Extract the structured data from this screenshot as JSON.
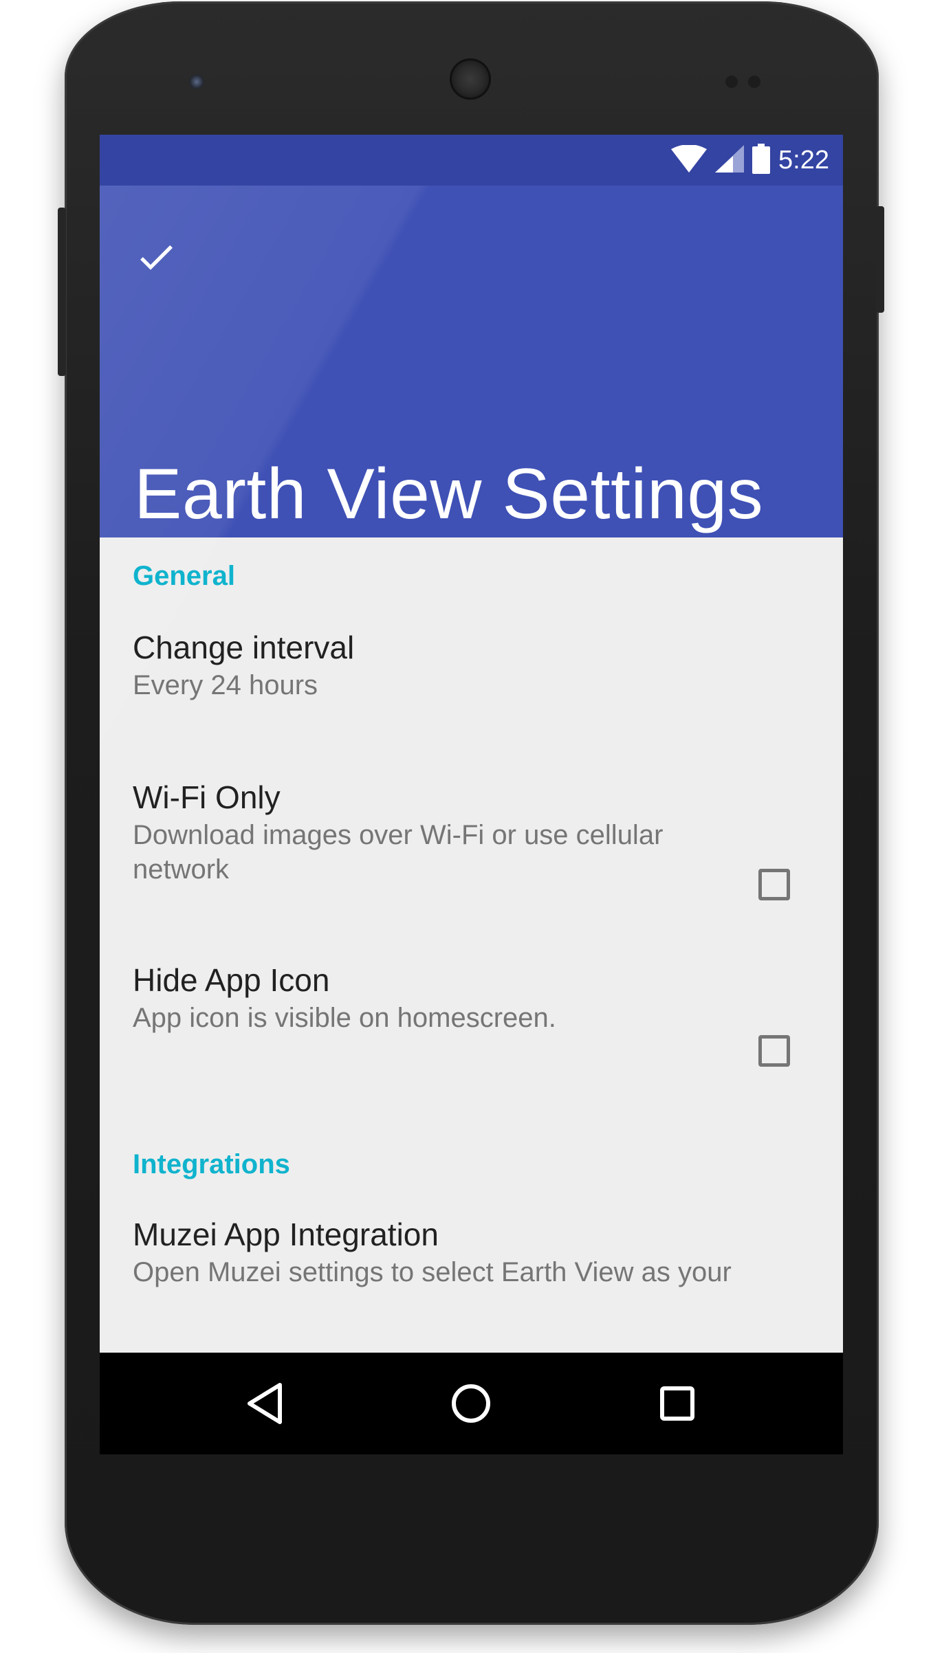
{
  "status_bar": {
    "time": "5:22",
    "icons": [
      "wifi-icon",
      "cell-signal-icon",
      "battery-icon"
    ]
  },
  "app_bar": {
    "action_icon": "check-icon",
    "title": "Earth View Settings",
    "color": "#3f51b5",
    "status_color": "#3444a3"
  },
  "sections": {
    "general": {
      "header": "General",
      "change_interval": {
        "title": "Change interval",
        "summary": "Every 24 hours"
      },
      "wifi_only": {
        "title": "Wi-Fi Only",
        "summary": "Download images over Wi-Fi or use cellular network",
        "checked": false
      },
      "hide_app_icon": {
        "title": "Hide App Icon",
        "summary": "App icon is visible on homescreen.",
        "checked": false
      }
    },
    "integrations": {
      "header": "Integrations",
      "muzei": {
        "title": "Muzei App Integration",
        "summary": "Open Muzei settings to select Earth View as your"
      }
    }
  },
  "accent_color": "#10b3cd",
  "nav_bar": {
    "icons": [
      "back-icon",
      "home-icon",
      "recents-icon"
    ]
  }
}
